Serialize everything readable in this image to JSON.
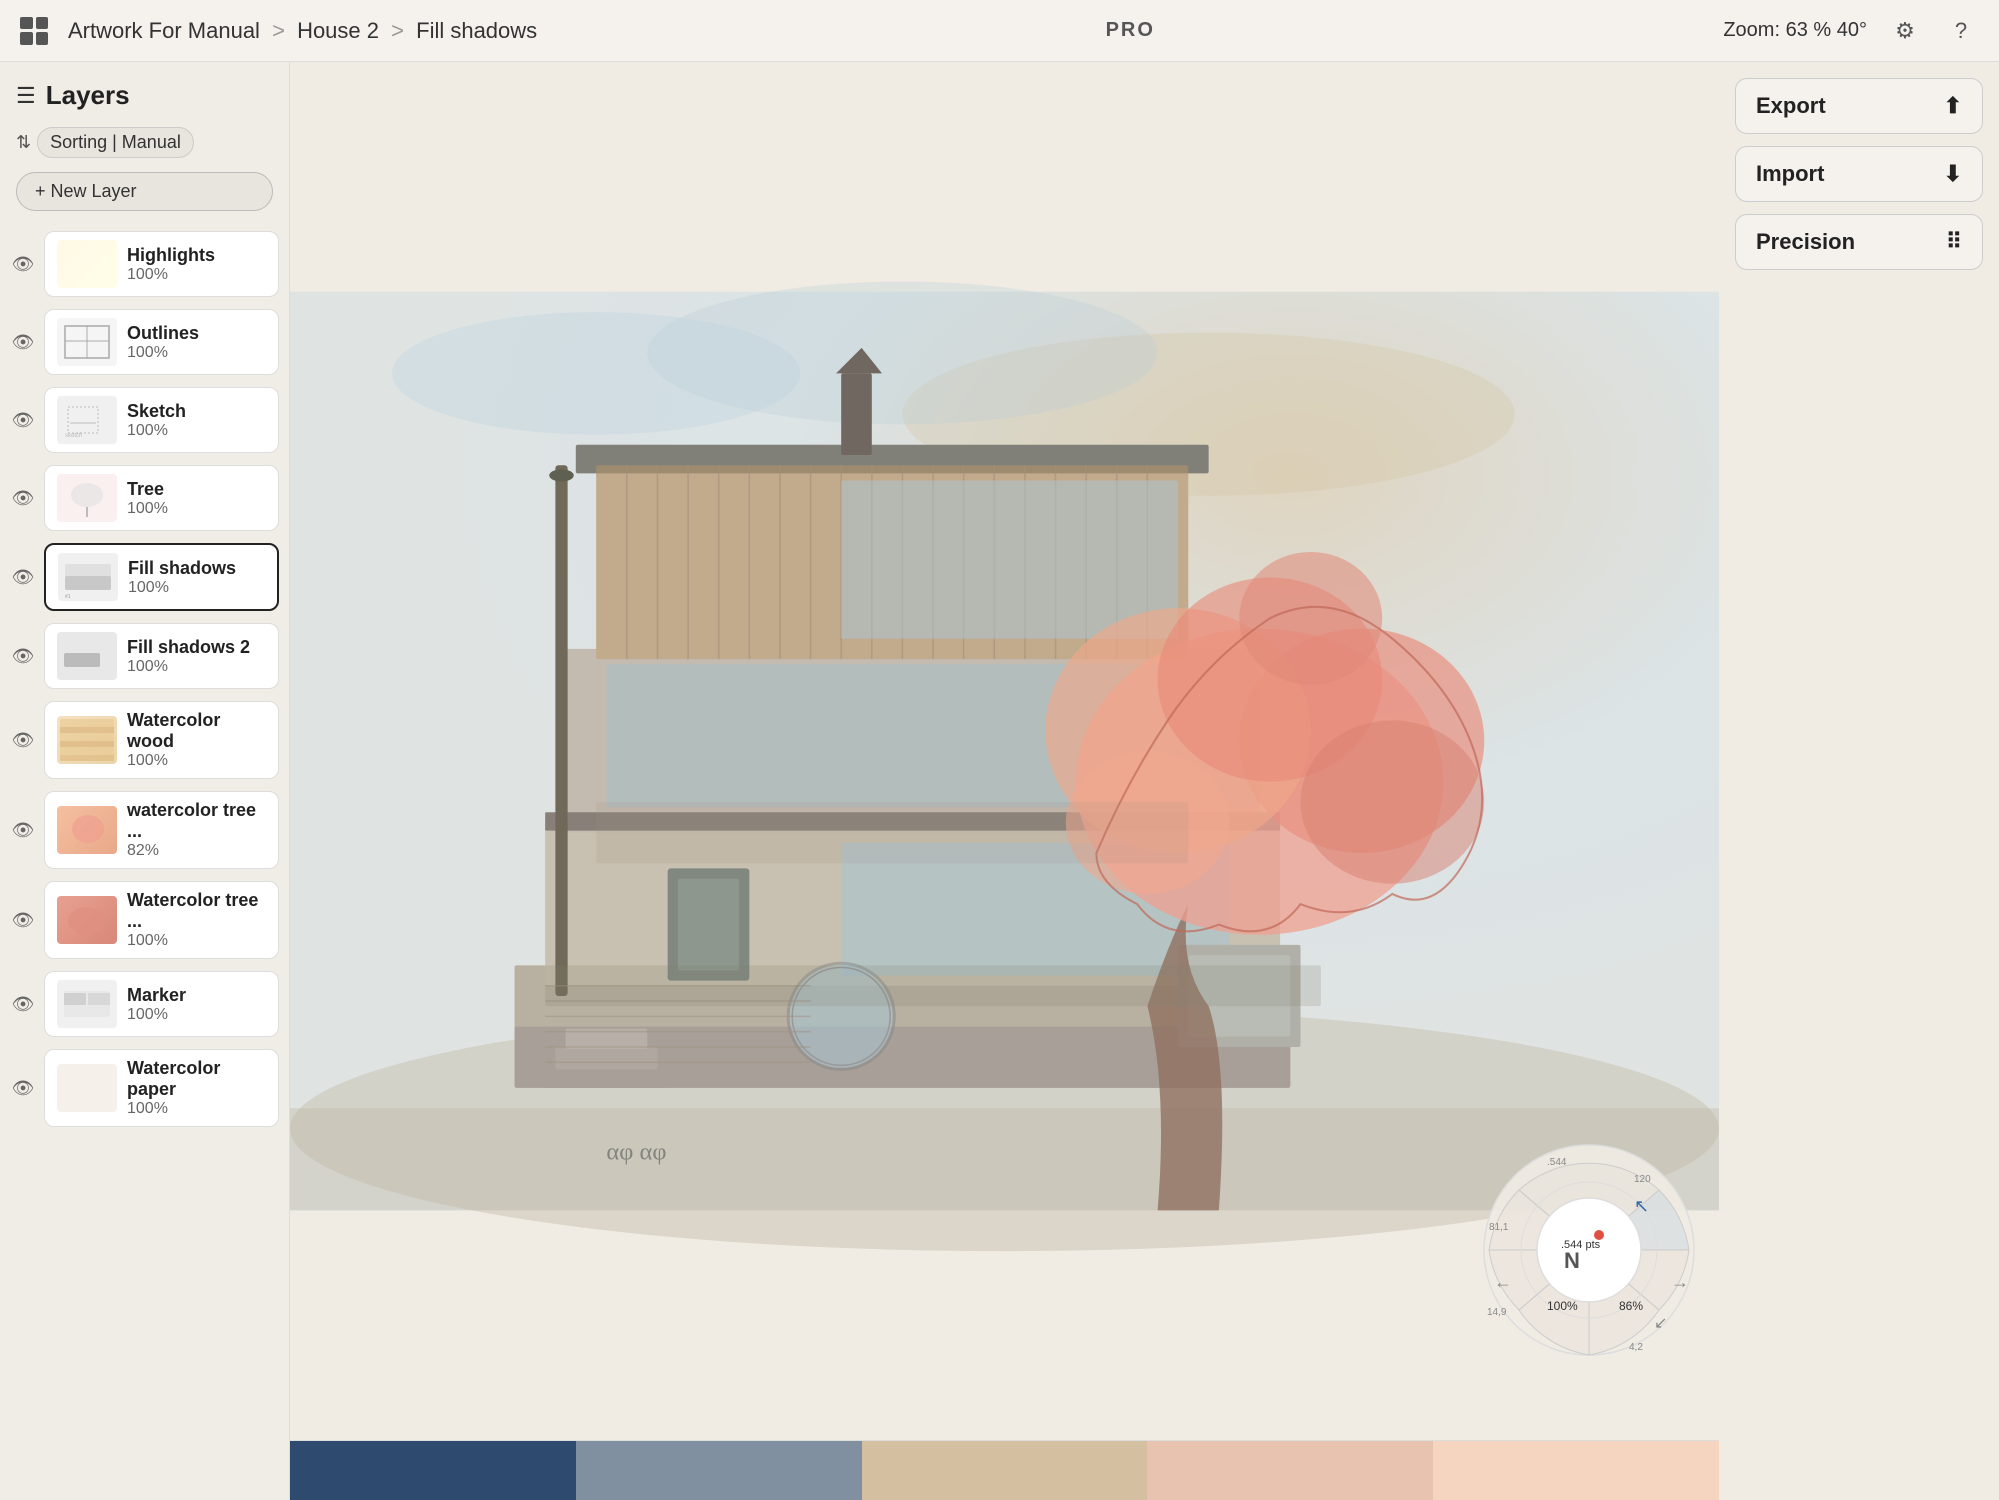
{
  "header": {
    "breadcrumb": {
      "project": "Artwork For Manual",
      "sep1": ">",
      "folder": "House 2",
      "sep2": ">",
      "current": "Fill shadows"
    },
    "badge": "PRO",
    "zoom_label": "Zoom:",
    "zoom_value": "63 %",
    "zoom_angle": "40°",
    "settings_icon": "gear-icon",
    "help_icon": "help-icon"
  },
  "left_panel": {
    "menu_icon": "☰",
    "title": "Layers",
    "sorting_icon": "⇅",
    "sorting_label": "Sorting | Manual",
    "new_layer_label": "+ New Layer",
    "layers": [
      {
        "id": "highlights",
        "name": "Highlights",
        "opacity": "100%",
        "visible": true,
        "active": false
      },
      {
        "id": "outlines",
        "name": "Outlines",
        "opacity": "100%",
        "visible": true,
        "active": false
      },
      {
        "id": "sketch",
        "name": "Sketch",
        "opacity": "100%",
        "visible": true,
        "active": false
      },
      {
        "id": "tree",
        "name": "Tree",
        "opacity": "100%",
        "visible": true,
        "active": false
      },
      {
        "id": "fillshadows",
        "name": "Fill shadows",
        "opacity": "100%",
        "visible": true,
        "active": true
      },
      {
        "id": "fillshadows2",
        "name": "Fill shadows 2",
        "opacity": "100%",
        "visible": true,
        "active": false
      },
      {
        "id": "wcwood",
        "name": "Watercolor wood",
        "opacity": "100%",
        "visible": true,
        "active": false
      },
      {
        "id": "wctree1",
        "name": "watercolor tree ...",
        "opacity": "82%",
        "visible": true,
        "active": false
      },
      {
        "id": "wctree2",
        "name": "Watercolor tree ...",
        "opacity": "100%",
        "visible": true,
        "active": false
      },
      {
        "id": "marker",
        "name": "Marker",
        "opacity": "100%",
        "visible": true,
        "active": false
      },
      {
        "id": "wcpaper",
        "name": "Watercolor paper",
        "opacity": "100%",
        "visible": true,
        "active": false
      }
    ]
  },
  "right_panel": {
    "export_label": "Export",
    "import_label": "Import",
    "precision_label": "Precision"
  },
  "wheel": {
    "value1": ".544 pts",
    "value2": "100%",
    "value3": "86%",
    "n1": "81,1",
    "n2": "14,9",
    "n3": "4,2",
    "n4": ".544",
    "n5": "120"
  },
  "color_strip": {
    "colors": [
      "#2e4a6e",
      "#c0c0c0",
      "#d4c0a0",
      "#e8c4b0",
      "#f5d4c0"
    ]
  }
}
